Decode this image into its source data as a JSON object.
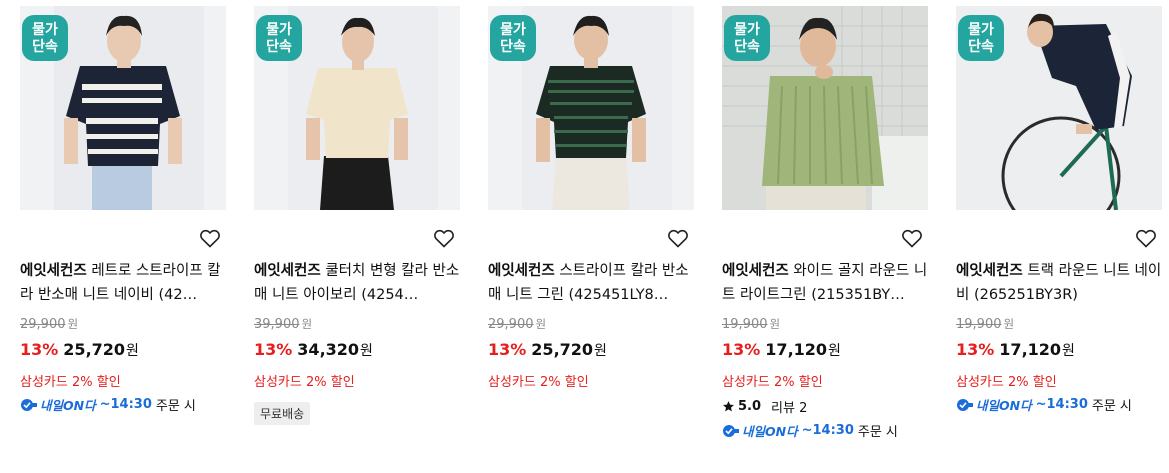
{
  "badge_text_line1": "물가",
  "badge_text_line2": "단속",
  "products": [
    {
      "brand": "에잇세컨즈",
      "name": "레트로 스트라이프 칼라 반소매 니트 네이비 (42…",
      "original_price": "29,900",
      "currency": "원",
      "discount": "13%",
      "sale_price": "25,720",
      "card_promo": "삼성카드 2% 할인",
      "delivery_logo": "내일ON다",
      "delivery_time": "~14:30",
      "delivery_suffix": "주문 시"
    },
    {
      "brand": "에잇세컨즈",
      "name": "쿨터치 변형 칼라 반소매 니트 아이보리 (4254…",
      "original_price": "39,900",
      "currency": "원",
      "discount": "13%",
      "sale_price": "34,320",
      "card_promo": "삼성카드 2% 할인",
      "free_shipping": "무료배송"
    },
    {
      "brand": "에잇세컨즈",
      "name": "스트라이프 칼라 반소매 니트 그린 (425451LY8…",
      "original_price": "29,900",
      "currency": "원",
      "discount": "13%",
      "sale_price": "25,720",
      "card_promo": "삼성카드 2% 할인"
    },
    {
      "brand": "에잇세컨즈",
      "name": "와이드 골지 라운드 니트 라이트그린 (215351BY…",
      "original_price": "19,900",
      "currency": "원",
      "discount": "13%",
      "sale_price": "17,120",
      "card_promo": "삼성카드 2% 할인",
      "rating": "5.0",
      "review_label": "리뷰 2",
      "delivery_logo": "내일ON다",
      "delivery_time": "~14:30",
      "delivery_suffix": "주문 시"
    },
    {
      "brand": "에잇세컨즈",
      "name": "트랙 라운드 니트 네이비 (265251BY3R)",
      "original_price": "19,900",
      "currency": "원",
      "discount": "13%",
      "sale_price": "17,120",
      "card_promo": "삼성카드 2% 할인",
      "delivery_logo": "내일ON다",
      "delivery_time": "~14:30",
      "delivery_suffix": "주문 시"
    }
  ],
  "colors": {
    "badge": "#25a59f",
    "discount": "#e61e1e",
    "delivery": "#1a6dd9"
  }
}
